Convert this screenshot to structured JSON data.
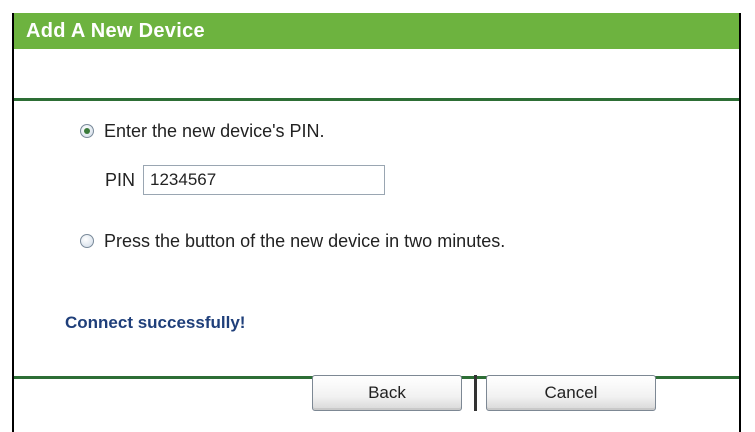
{
  "header": {
    "title": "Add A New Device"
  },
  "options": {
    "pin_option": {
      "label": "Enter the new device's PIN.",
      "selected": true
    },
    "pin_field": {
      "label": "PIN",
      "value": "1234567"
    },
    "button_option": {
      "label": "Press the button of the new device in two minutes.",
      "selected": false
    }
  },
  "status": {
    "message": "Connect successfully!"
  },
  "buttons": {
    "back_label": "Back",
    "cancel_label": "Cancel"
  },
  "colors": {
    "title_bar": "#6db33f",
    "divider": "#2d6e35",
    "status_text": "#1f3f7a"
  }
}
